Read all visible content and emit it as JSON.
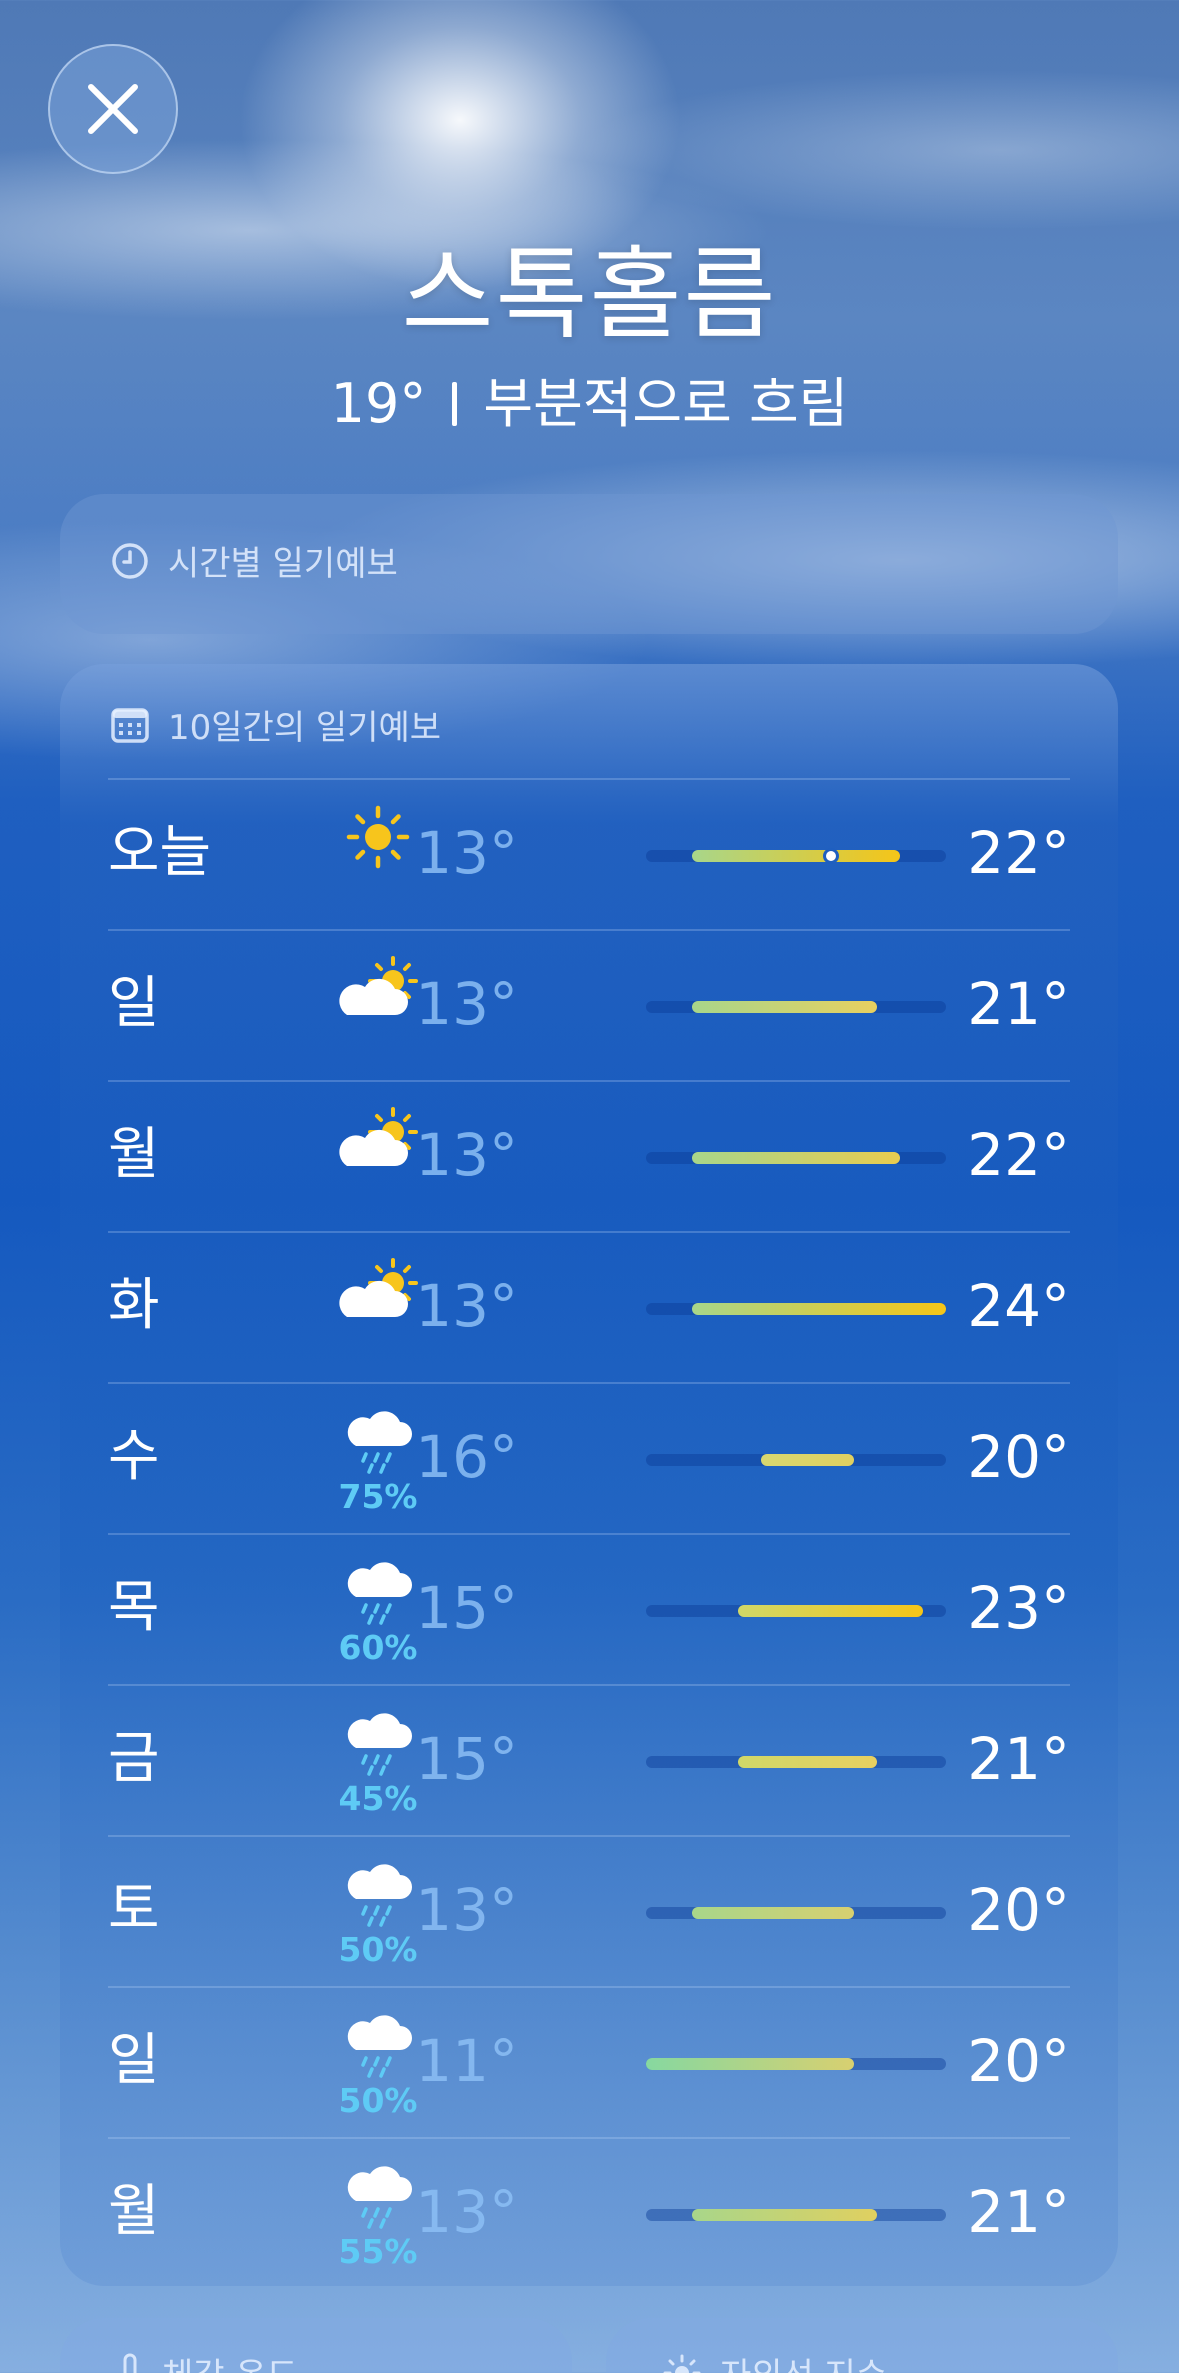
{
  "location": {
    "city": "스톡홀름",
    "current_temp": "19°",
    "condition": "부분적으로 흐림"
  },
  "hourly_card": {
    "title": "시간별 일기예보",
    "icon": "clock-icon"
  },
  "daily_card": {
    "title": "10일간의 일기예보",
    "icon": "calendar-icon",
    "scale": {
      "min": 11,
      "max": 24
    },
    "current_temp_value": 19,
    "days": [
      {
        "day": "오늘",
        "icon": "sun-icon",
        "pop": "",
        "low": "13°",
        "high": "22°",
        "low_value": 13,
        "high_value": 22,
        "gradient": [
          "#a8d68a",
          "#f5c518"
        ]
      },
      {
        "day": "일",
        "icon": "partly-cloudy-icon",
        "pop": "",
        "low": "13°",
        "high": "21°",
        "low_value": 13,
        "high_value": 21,
        "gradient": [
          "#a8d68a",
          "#e8d060"
        ]
      },
      {
        "day": "월",
        "icon": "partly-cloudy-icon",
        "pop": "",
        "low": "13°",
        "high": "22°",
        "low_value": 13,
        "high_value": 22,
        "gradient": [
          "#a8d68a",
          "#e8cc50"
        ]
      },
      {
        "day": "화",
        "icon": "partly-cloudy-icon",
        "pop": "",
        "low": "13°",
        "high": "24°",
        "low_value": 13,
        "high_value": 24,
        "gradient": [
          "#a8d68a",
          "#f5c518"
        ]
      },
      {
        "day": "수",
        "icon": "rain-icon",
        "pop": "75%",
        "low": "16°",
        "high": "20°",
        "low_value": 16,
        "high_value": 20,
        "gradient": [
          "#d8d870",
          "#e0d060"
        ]
      },
      {
        "day": "목",
        "icon": "rain-icon",
        "pop": "60%",
        "low": "15°",
        "high": "23°",
        "low_value": 15,
        "high_value": 23,
        "gradient": [
          "#d0d868",
          "#f5c518"
        ]
      },
      {
        "day": "금",
        "icon": "rain-icon",
        "pop": "45%",
        "low": "15°",
        "high": "21°",
        "low_value": 15,
        "high_value": 21,
        "gradient": [
          "#d0d868",
          "#e8d060"
        ]
      },
      {
        "day": "토",
        "icon": "rain-icon",
        "pop": "50%",
        "low": "13°",
        "high": "20°",
        "low_value": 13,
        "high_value": 20,
        "gradient": [
          "#a8d68a",
          "#d8d070"
        ]
      },
      {
        "day": "일",
        "icon": "rain-icon",
        "pop": "50%",
        "low": "11°",
        "high": "20°",
        "low_value": 11,
        "high_value": 20,
        "gradient": [
          "#86d8a0",
          "#d8d070"
        ]
      },
      {
        "day": "월",
        "icon": "rain-icon",
        "pop": "55%",
        "low": "13°",
        "high": "21°",
        "low_value": 13,
        "high_value": 21,
        "gradient": [
          "#a8d68a",
          "#e0d060"
        ]
      }
    ]
  },
  "bottom_cards": [
    {
      "title": "체감 온도",
      "icon": "thermometer-icon"
    },
    {
      "title": "자외선 지수",
      "icon": "sun-icon"
    }
  ],
  "close_icon": "close-icon"
}
